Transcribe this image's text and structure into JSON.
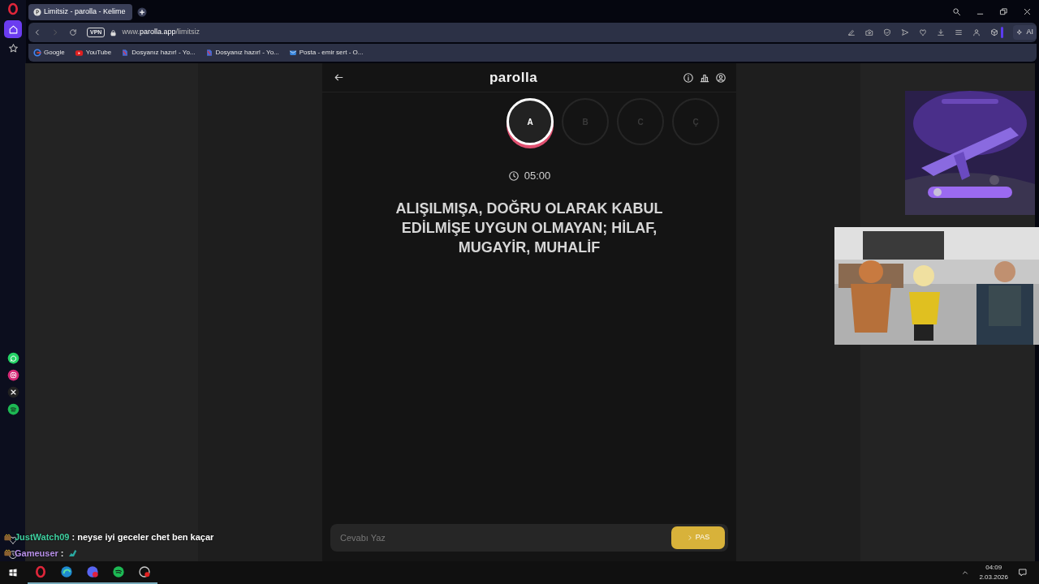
{
  "browser": {
    "tabs": [
      {
        "title": "Limitsiz - parolla - Kelime",
        "selected": true
      }
    ],
    "vpn": "VPN",
    "url": "www.**parolla.app**/limitsiz",
    "ai_button": "AI",
    "bookmarks": [
      {
        "label": "Google",
        "kind": "google"
      },
      {
        "label": "YouTube",
        "kind": "youtube"
      },
      {
        "label": "Dosyanız hazır! - Yo...",
        "kind": "file"
      },
      {
        "label": "Dosyanız hazır! - Yo...",
        "kind": "file"
      },
      {
        "label": "Posta - emir sert - O...",
        "kind": "mail"
      }
    ]
  },
  "app": {
    "title": "parolla",
    "letters": [
      {
        "label": "A",
        "selected": true
      },
      {
        "label": "B",
        "selected": false
      },
      {
        "label": "C",
        "selected": false
      },
      {
        "label": "Ç",
        "selected": false
      }
    ],
    "timer": "05:00",
    "question": "ALIŞILMIŞA, DOĞRU OLARAK KABUL EDİLMİŞE UYGUN OLMAYAN; HİLAF, MUGAYİR, MUHALİF",
    "answer": {
      "placeholder": "Cevabı Yaz"
    },
    "pass_button": "PAS"
  },
  "chat": [
    {
      "user": "JustWatch09",
      "color": "#3fd0a0",
      "text": ": neyse iyi geceler chet ben kaçar"
    },
    {
      "user": "Gameuser",
      "color": "#b890e8",
      "text": ":",
      "emote": true
    }
  ],
  "taskbar": {
    "time": "04:09",
    "date": "2.03.2026"
  }
}
